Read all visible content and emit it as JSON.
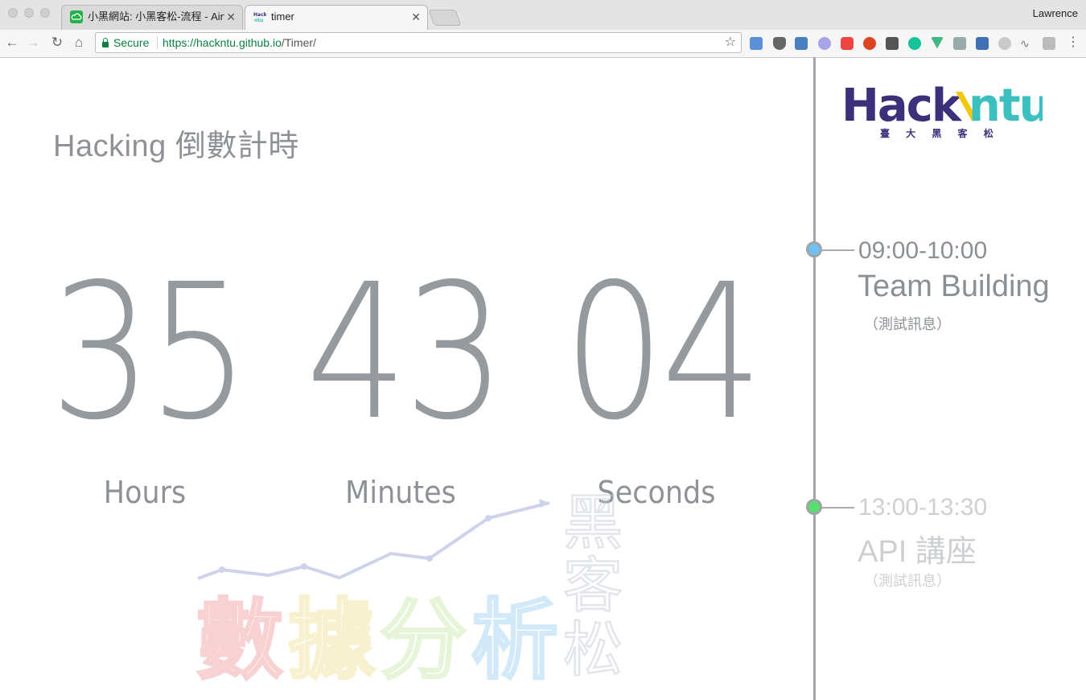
{
  "browser": {
    "tabs": [
      {
        "title": "小黑網站: 小黑客松-流程 - Airta",
        "favicon": "airtable-cloud-icon",
        "active": false
      },
      {
        "title": "timer",
        "favicon": "hackntu-favicon",
        "active": true
      }
    ],
    "user": "Lawrence",
    "secure_label": "Secure",
    "url_scheme_host": "https://hacknt​u.github.io",
    "url_path": "/Timer/"
  },
  "page": {
    "title": "Hacking 倒數計時",
    "hours": "35",
    "minutes": "43",
    "seconds": "04",
    "hours_label": "Hours",
    "minutes_label": "Minutes",
    "seconds_label": "Seconds"
  },
  "logo": {
    "wordmark": "Hackntu",
    "subtitle": "臺 大 黑 客 松",
    "colors": {
      "purple": "#3d2f7a",
      "yellow": "#f2c80f",
      "teal": "#3bbfbf"
    }
  },
  "watermark": {
    "text": "數據分析",
    "side_text": "黑客松"
  },
  "timeline": [
    {
      "time": "09:00-10:00",
      "title": "Team Building",
      "note": "（測試訊息）",
      "dot_color": "#6ec1f2",
      "state": "active"
    },
    {
      "time": "13:00-13:30",
      "title": "API 講座",
      "note": "（測試訊息）",
      "dot_color": "#56e06c",
      "state": "upcoming"
    }
  ]
}
